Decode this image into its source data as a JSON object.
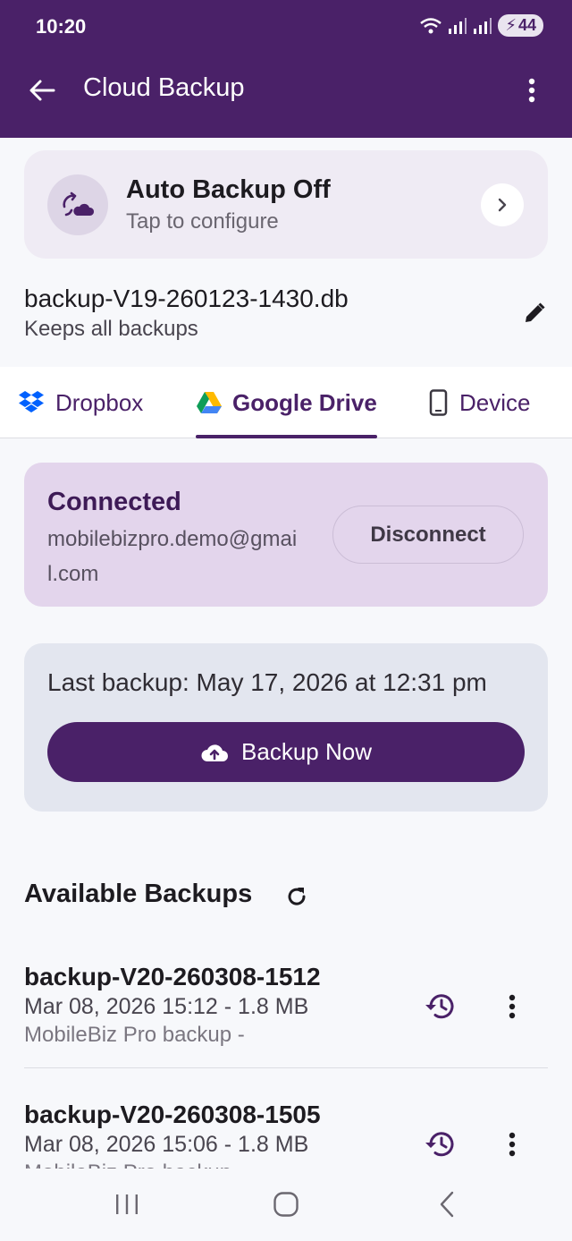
{
  "status_bar": {
    "time": "10:20",
    "battery": "44"
  },
  "app_bar": {
    "title": "Cloud Backup"
  },
  "auto_backup": {
    "title": "Auto Backup Off",
    "subtitle": "Tap to configure"
  },
  "file": {
    "name": "backup-V19-260123-1430.db",
    "retention": "Keeps all backups"
  },
  "tabs": [
    {
      "label": "Dropbox",
      "icon": "dropbox-icon"
    },
    {
      "label": "Google Drive",
      "icon": "google-drive-icon",
      "active": true
    },
    {
      "label": "Device",
      "icon": "phone-icon"
    }
  ],
  "connection": {
    "status": "Connected",
    "email": "mobilebizpro.demo@gmail.com",
    "disconnect_label": "Disconnect"
  },
  "last_backup": {
    "text": "Last backup: May 17, 2026 at 12:31 pm",
    "button_label": "Backup Now"
  },
  "available": {
    "title": "Available Backups",
    "items": [
      {
        "name": "backup-V20-260308-1512",
        "meta": "Mar 08, 2026 15:12 - 1.8 MB",
        "desc": "MobileBiz Pro backup -"
      },
      {
        "name": "backup-V20-260308-1505",
        "meta": "Mar 08, 2026 15:06 - 1.8 MB",
        "desc": "MobileBiz Pro backup"
      }
    ]
  },
  "colors": {
    "primary": "#4a2168",
    "connected_bg": "#e3d5ec",
    "card_bg": "#e3e6ef"
  }
}
